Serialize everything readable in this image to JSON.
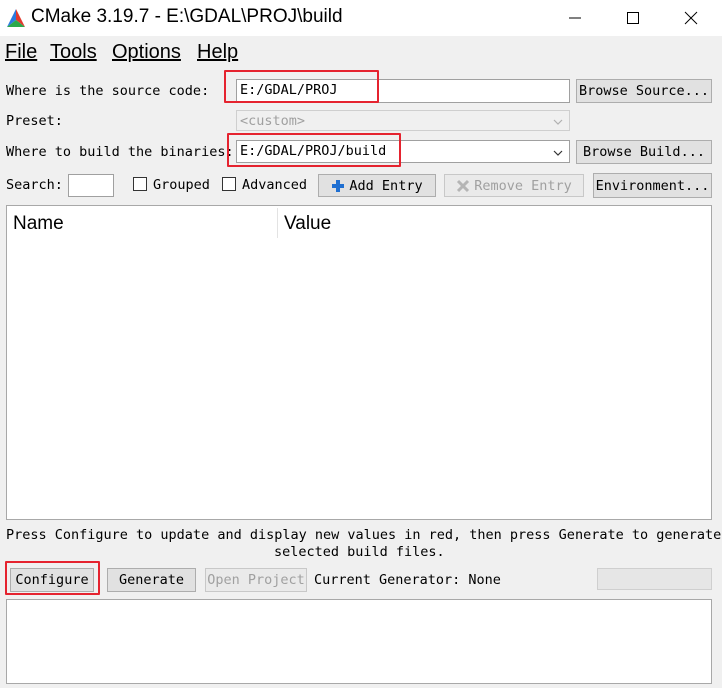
{
  "window": {
    "title": "CMake 3.19.7 - E:\\GDAL\\PROJ\\build",
    "minimize": "—",
    "maximize": "☐",
    "close": "✕"
  },
  "menu": {
    "items": [
      "File",
      "Tools",
      "Options",
      "Help"
    ]
  },
  "source": {
    "label": "Where is the source code:",
    "value": "E:/GDAL/PROJ",
    "browse": "Browse Source..."
  },
  "preset": {
    "label": "Preset:",
    "value": "<custom>"
  },
  "build": {
    "label": "Where to build the binaries:",
    "value": "E:/GDAL/PROJ/build",
    "browse": "Browse Build..."
  },
  "search": {
    "label": "Search:",
    "value": "",
    "grouped": {
      "label": "Grouped",
      "checked": false
    },
    "advanced": {
      "label": "Advanced",
      "checked": false
    },
    "add_entry": "Add Entry",
    "remove_entry": "Remove Entry",
    "environment": "Environment..."
  },
  "table": {
    "columns": [
      "Name",
      "Value"
    ],
    "rows": []
  },
  "info_text": {
    "line1": "Press Configure to update and display new values in red, then press Generate to generate",
    "line2": "selected build files."
  },
  "actions": {
    "configure": "Configure",
    "generate": "Generate",
    "open_project": "Open Project",
    "generator_text": "Current Generator: None"
  },
  "colors": {
    "highlight": "#e5232f",
    "add_icon": "#1f6fd1"
  }
}
